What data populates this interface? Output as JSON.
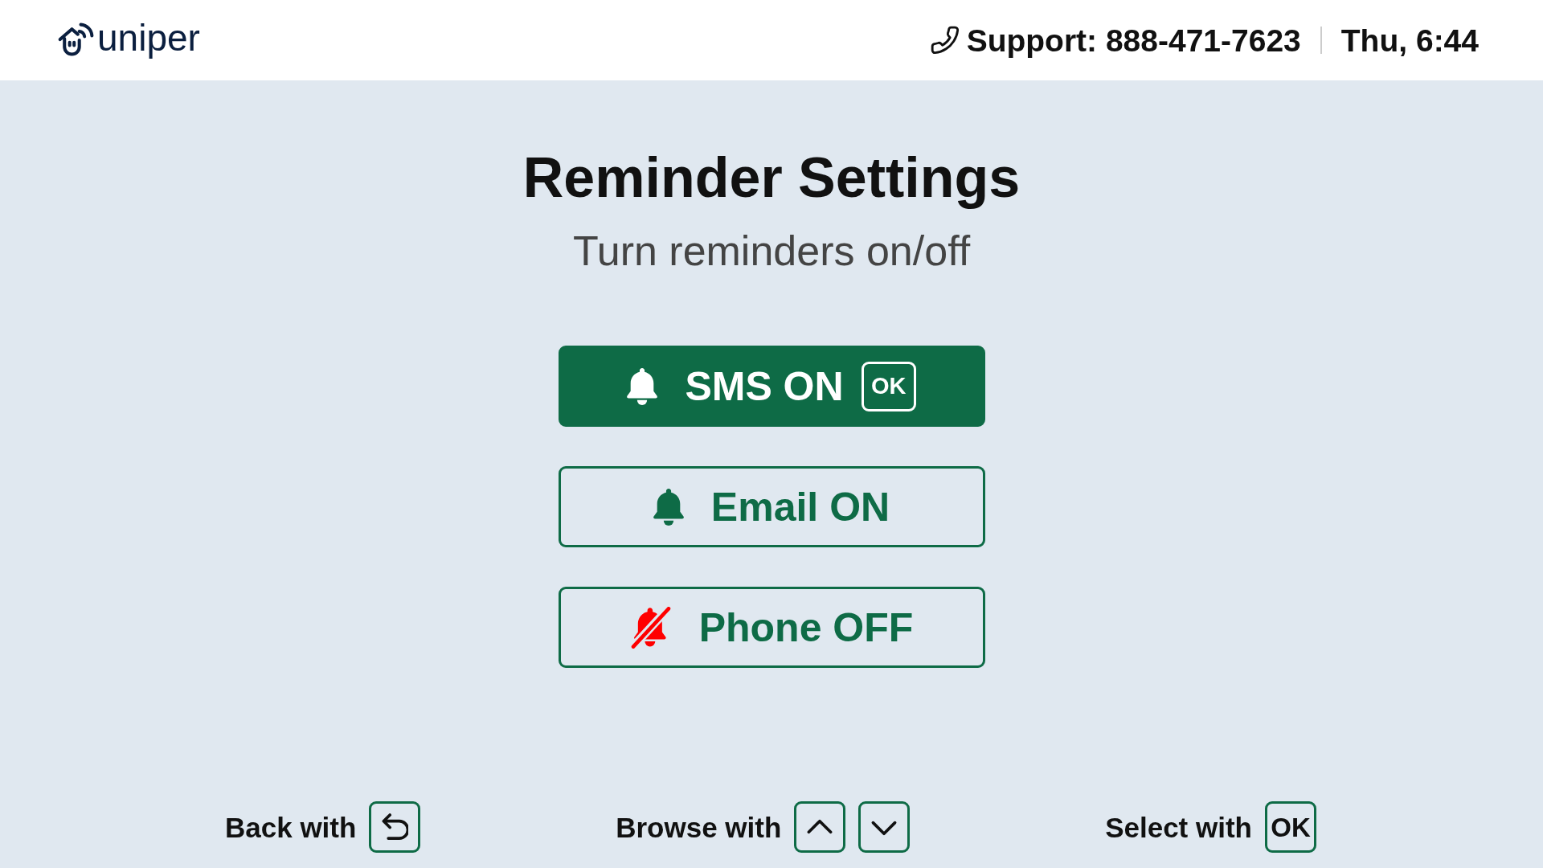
{
  "header": {
    "logo_text": "uniper",
    "support": "Support: 888-471-7623",
    "datetime": "Thu, 6:44"
  },
  "title": "Reminder Settings",
  "subtitle": "Turn reminders on/off",
  "options": [
    {
      "label": "SMS ON",
      "on": true,
      "selected": true,
      "key_hint": "OK"
    },
    {
      "label": "Email ON",
      "on": true,
      "selected": false
    },
    {
      "label": "Phone OFF",
      "on": false,
      "selected": false
    }
  ],
  "footer": [
    {
      "label": "Back with",
      "keys": [
        {
          "kind": "back"
        }
      ]
    },
    {
      "label": "Browse with",
      "keys": [
        {
          "kind": "up"
        },
        {
          "kind": "down"
        }
      ]
    },
    {
      "label": "Select with",
      "keys": [
        {
          "kind": "text",
          "text": "OK"
        }
      ]
    }
  ]
}
